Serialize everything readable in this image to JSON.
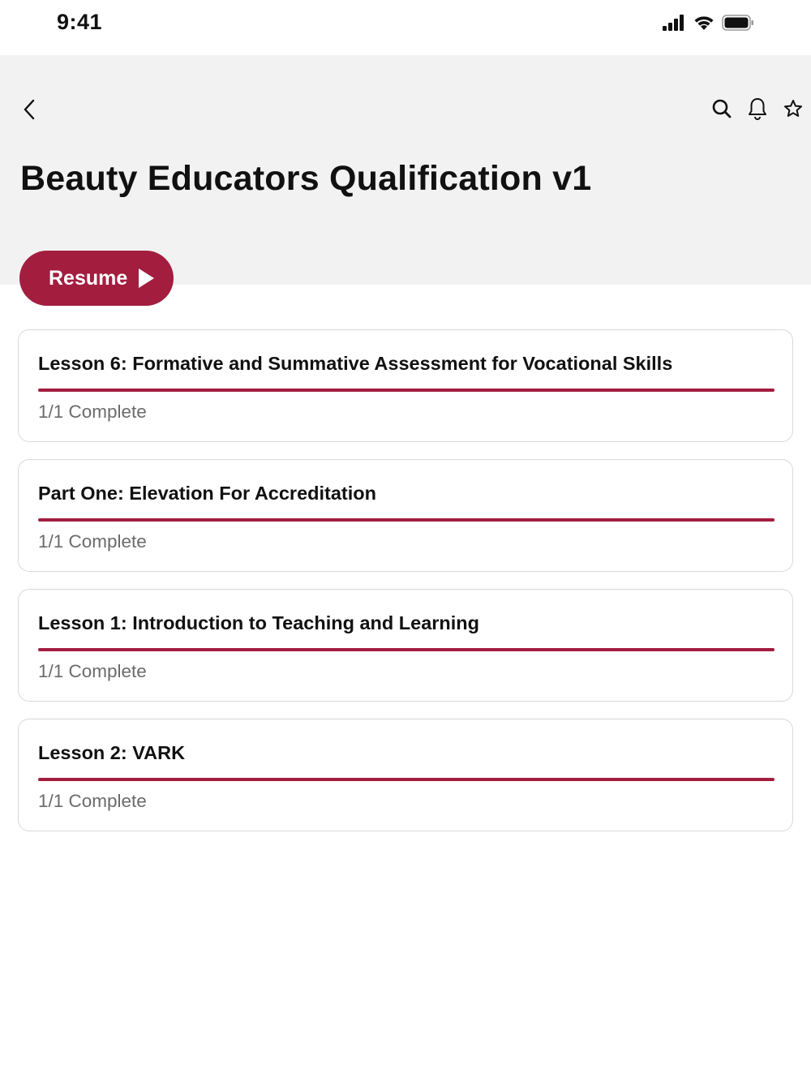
{
  "status_bar": {
    "time": "9:41",
    "icons": [
      "cellular-signal-icon",
      "wifi-icon",
      "battery-icon"
    ]
  },
  "header": {
    "title": "Beauty Educators Qualification v1",
    "actions": [
      "search-icon",
      "bell-icon",
      "star-icon"
    ]
  },
  "resume_button": {
    "label": "Resume",
    "icon": "play-icon"
  },
  "colors": {
    "accent": "#a31d3f",
    "header_bg": "#f2f2f2",
    "card_border": "#d9d9d9",
    "muted_text": "#6b6b6b"
  },
  "lessons": [
    {
      "title": "Lesson 6: Formative and Summative Assessment for Vocational Skills",
      "status": "1/1 Complete",
      "progress": 1.0
    },
    {
      "title": "Part One: Elevation For Accreditation",
      "status": "1/1 Complete",
      "progress": 1.0
    },
    {
      "title": "Lesson 1: Introduction to Teaching and Learning",
      "status": "1/1 Complete",
      "progress": 1.0
    },
    {
      "title": "Lesson 2: VARK",
      "status": "1/1 Complete",
      "progress": 1.0
    }
  ]
}
